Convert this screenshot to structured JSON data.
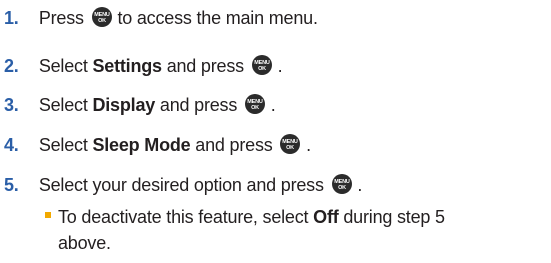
{
  "steps": [
    {
      "num": "1.",
      "pre": "Press ",
      "post": " to access the main menu."
    },
    {
      "num": "2.",
      "pre": "Select ",
      "bold": "Settings",
      "mid": " and press ",
      "post": "."
    },
    {
      "num": "3.",
      "pre": "Select ",
      "bold": "Display",
      "mid": " and press ",
      "post": "."
    },
    {
      "num": "4.",
      "pre": "Select ",
      "bold": "Sleep Mode",
      "mid": " and press ",
      "post": "."
    },
    {
      "num": "5.",
      "pre": "Select your desired option and press ",
      "post": "."
    }
  ],
  "note": {
    "pre": "To deactivate this feature, select ",
    "bold": "Off",
    "post": " during step 5",
    "line2": "above."
  },
  "key_icon": {
    "name": "menu-ok-key-icon",
    "top": "MENU",
    "bottom": "OK",
    "color": "#2b2b2b"
  },
  "colors": {
    "number": "#2a5ea7",
    "bullet": "#f2a900",
    "text": "#231f20"
  }
}
